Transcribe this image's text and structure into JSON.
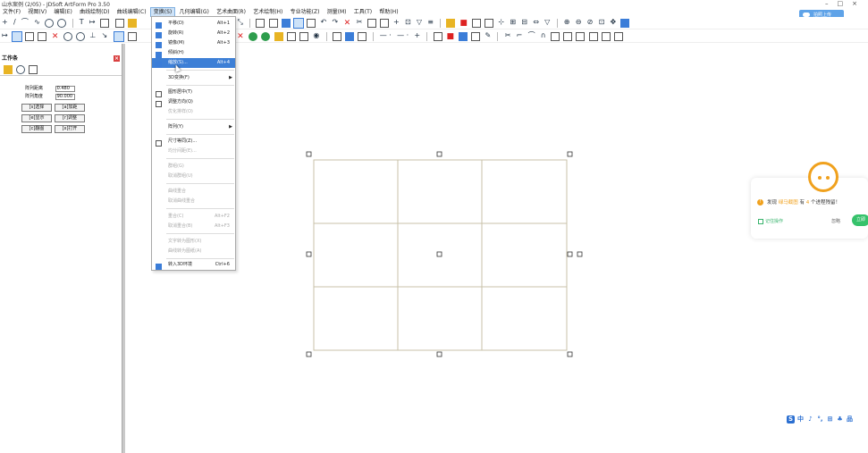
{
  "window": {
    "title": "山水案例 (2/05) - JDSoft ArtForm Pro 3.50"
  },
  "menubar": {
    "items": [
      {
        "label": "文件(F)"
      },
      {
        "label": "视图(V)"
      },
      {
        "label": "编辑(E)"
      },
      {
        "label": "曲线绘制(D)"
      },
      {
        "label": "曲线编辑(C)"
      },
      {
        "label": "变换(S)",
        "active": true
      },
      {
        "label": "几何编辑(G)"
      },
      {
        "label": "艺术曲面(R)"
      },
      {
        "label": "艺术绘制(H)"
      },
      {
        "label": "专业功能(Z)"
      },
      {
        "label": "测量(M)"
      },
      {
        "label": "工具(T)"
      },
      {
        "label": "帮助(H)"
      }
    ]
  },
  "upload_button": {
    "label": "拍照上传"
  },
  "work_panel": {
    "title": "工作条",
    "params": [
      {
        "label": "阵列距离",
        "value": "0.480"
      },
      {
        "label": "阵列角度",
        "value": "90.000"
      }
    ],
    "buttons": [
      "[s]选择",
      "[a]加距",
      "[e]显示",
      "[r]调整",
      "[c]翻图",
      "[x]打开"
    ]
  },
  "transform_menu": {
    "items": [
      {
        "label": "平移(D)",
        "shortcut": "Alt+1"
      },
      {
        "label": "旋转(R)",
        "shortcut": "Alt+2"
      },
      {
        "label": "镜像(M)",
        "shortcut": "Alt+3"
      },
      {
        "label": "倾斜(H)",
        "shortcut": ""
      },
      {
        "label": "缩放(S)...",
        "shortcut": "Alt+4",
        "highlighted": true
      },
      {
        "label": "3D变换(F)",
        "shortcut": "",
        "submenu": true
      },
      {
        "label": "图形居中(T)",
        "shortcut": ""
      },
      {
        "label": "调整方向(Q)",
        "shortcut": ""
      },
      {
        "label": "优化排样(O)",
        "shortcut": "",
        "disabled": true
      },
      {
        "label": "阵列(Y)",
        "shortcut": "",
        "submenu": true
      },
      {
        "label": "尺寸等同(Z)...",
        "shortcut": ""
      },
      {
        "label": "均分间距(E)...",
        "shortcut": "",
        "disabled": true
      },
      {
        "label": "群组(G)",
        "shortcut": "",
        "disabled": true
      },
      {
        "label": "取消群组(U)",
        "shortcut": "",
        "disabled": true
      },
      {
        "label": "曲线重合",
        "shortcut": "",
        "disabled": true
      },
      {
        "label": "取消曲线重合",
        "shortcut": "",
        "disabled": true
      },
      {
        "label": "重合(C)",
        "shortcut": "Alt+F2",
        "disabled": true
      },
      {
        "label": "取消重合(B)",
        "shortcut": "Alt+F3",
        "disabled": true
      },
      {
        "label": "文字转为图形(X)",
        "shortcut": "",
        "disabled": true
      },
      {
        "label": "曲线转为图纸(A)",
        "shortcut": "",
        "disabled": true
      },
      {
        "label": "转入3D环境",
        "shortcut": "Ctrl+6"
      }
    ]
  },
  "notification": {
    "prefix": "发现",
    "app_name": "绿马截图",
    "middle": "有",
    "count": "4",
    "suffix": "个进程残留！",
    "checkbox_label": "记住操作",
    "ignore_label": "忽略",
    "action_label": "立即"
  },
  "ime": {
    "items": [
      "中",
      "♪",
      "°,",
      "⊞",
      "♣",
      "品",
      "⊿"
    ]
  },
  "colors": {
    "accent": "#3d7fd6",
    "grid_line": "#c9c2a8",
    "warning": "#f0a11d",
    "success": "#36c26b"
  }
}
